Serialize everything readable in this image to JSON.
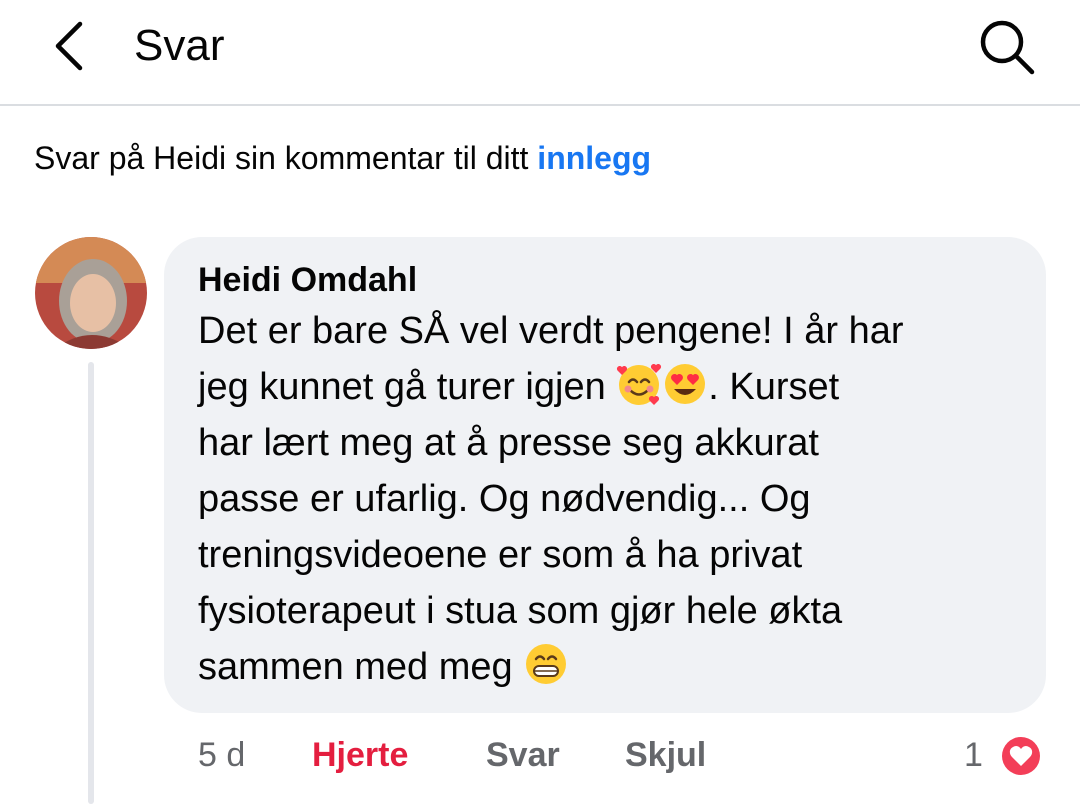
{
  "header": {
    "title": "Svar",
    "back_icon": "chevron-left-icon",
    "search_icon": "search-icon"
  },
  "context": {
    "prefix": "Svar på Heidi sin kommentar til ditt ",
    "link": "innlegg",
    "link_color": "#1877f2"
  },
  "comment": {
    "author": "Heidi Omdahl",
    "line1": "Det er bare SÅ vel verdt pengene! I år har",
    "line2_before": "jeg kunnet gå turer igjen ",
    "line2_emojis": [
      "smiling-face-with-hearts-emoji",
      "heart-eyes-emoji"
    ],
    "line2_after": ". Kurset",
    "line3": "har lært meg at å presse seg akkurat",
    "line4": "passe er ufarlig. Og nødvendig... Og",
    "line5": "treningsvideoene er som å ha privat",
    "line6": "fysioterapeut i stua som gjør hele økta",
    "line7_before": "sammen med meg ",
    "line7_emoji": "grinning-face-emoji",
    "time": "5 d",
    "actions": {
      "heart": "Hjerte",
      "reply": "Svar",
      "hide": "Skjul"
    },
    "reactions": {
      "count": "1",
      "icon": "heart-reaction-icon",
      "color": "#f33e58"
    }
  },
  "colors": {
    "bubble": "#f0f2f5",
    "heart_action": "#e41e3f",
    "meta": "#65676b"
  }
}
